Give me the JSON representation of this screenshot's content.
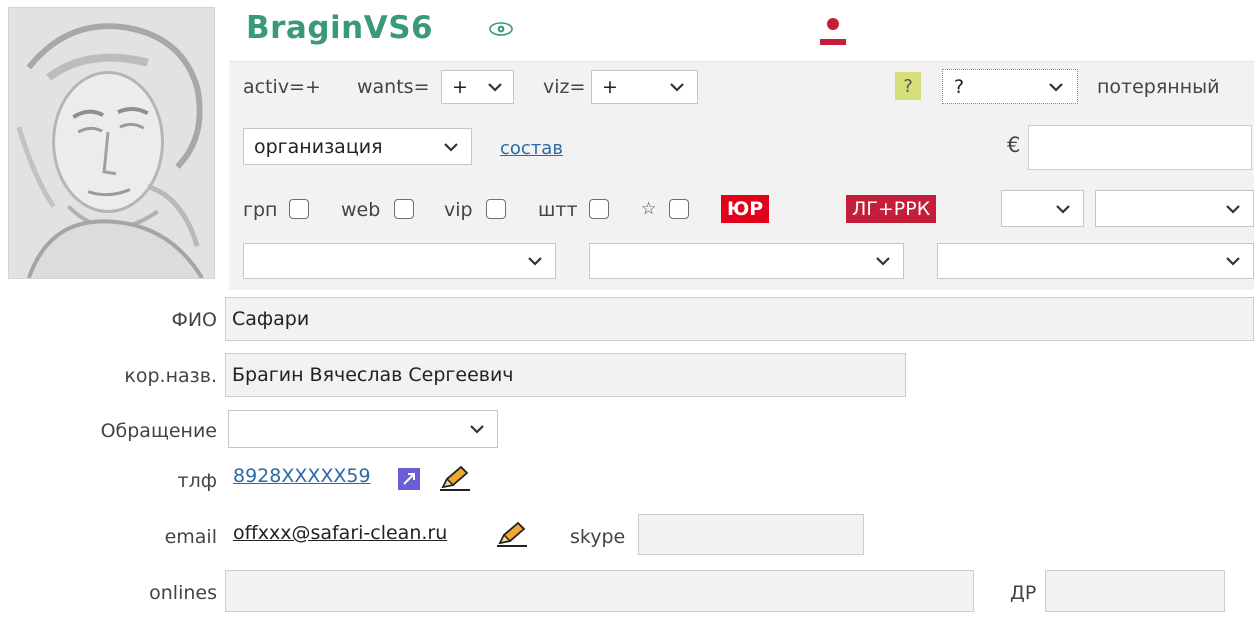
{
  "header": {
    "username": "BraginVS6",
    "eye_icon": "eye-icon",
    "person_icon": "person-icon",
    "person_color": "#c41e3a",
    "title_color": "#3a9a78"
  },
  "row1": {
    "activ_label": "activ=+",
    "wants_label": "wants=",
    "wants_value": "+",
    "viz_label": "viz=",
    "viz_value": "+",
    "question_badge": "?",
    "status_value": "?",
    "status_text": "потерянный"
  },
  "row2": {
    "type_value": "организация",
    "composition_link": "состав",
    "euro_symbol": "€",
    "euro_value": ""
  },
  "row3": {
    "grp_label": "грп",
    "web_label": "web",
    "vip_label": "vip",
    "stt_label": "штт",
    "star_label": "☆",
    "yur_tag": "ЮР",
    "lg_tag": "ЛГ+РРК",
    "select_a_value": "",
    "select_b_value": ""
  },
  "row4": {
    "select1_value": "",
    "select2_value": "",
    "select3_value": ""
  },
  "form": {
    "fio_label": "ФИО",
    "fio_value": "Сафари",
    "korname_label": "кор.назв.",
    "korname_value": "Брагин Вячеслав Сергеевич",
    "salutation_label": "Обращение",
    "salutation_value": "",
    "phone_label": "тлф",
    "phone_value": "8928XXXXX59",
    "email_label": "email",
    "email_value": "offxxx@safari-clean.ru",
    "skype_label": "skype",
    "skype_value": "",
    "onlines_label": "onlines",
    "onlines_value": "",
    "dr_label": "ДР",
    "dr_value": ""
  }
}
